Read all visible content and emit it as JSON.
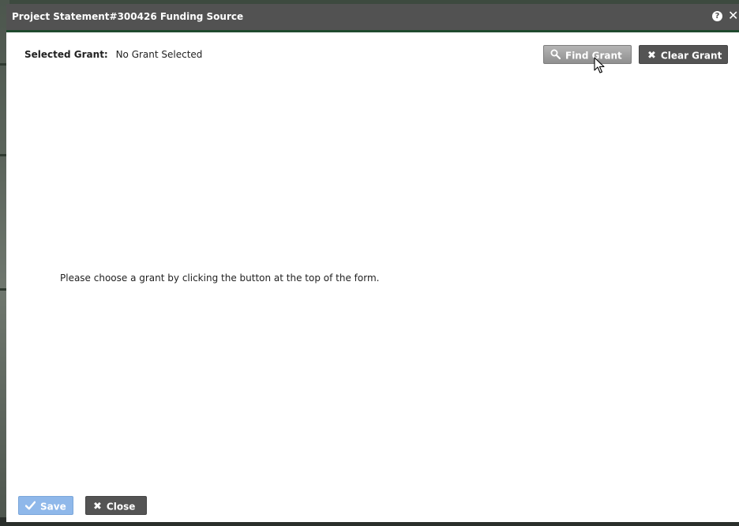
{
  "dialog": {
    "title": "Project Statement#300426 Funding Source",
    "help_icon": "question-circle-icon",
    "close_icon": "close-icon"
  },
  "grant": {
    "label": "Selected Grant:",
    "value": "No Grant Selected"
  },
  "toolbar": {
    "find_grant_label": "Find Grant",
    "find_grant_icon": "search-icon",
    "clear_grant_label": "Clear Grant",
    "clear_grant_icon": "x-icon"
  },
  "message": "Please choose a grant by clicking the button at the top of the form.",
  "footer": {
    "save_label": "Save",
    "save_icon": "checkmark-icon",
    "save_enabled": false,
    "close_label": "Close",
    "close_icon": "x-icon"
  },
  "colors": {
    "titlebar": "#525252",
    "accent_strip": "#1f4a2e",
    "dark_button": "#545454",
    "save_disabled": "#8fb8ea"
  }
}
